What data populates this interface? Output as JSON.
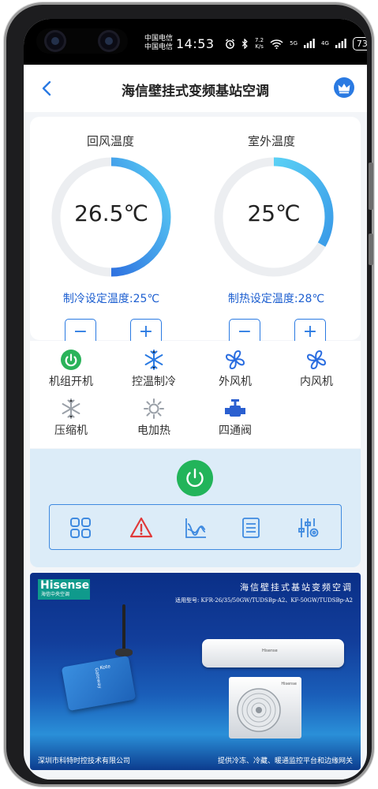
{
  "status_bar": {
    "carrier_1": "中国电信",
    "carrier_2": "中国电信",
    "time": "14:53",
    "net_speed_value": "7.2",
    "net_speed_unit": "K/s",
    "signal_1_tag": "5G",
    "signal_2_tag": "4G",
    "battery": "73"
  },
  "header": {
    "title": "海信壁挂式变频基站空调"
  },
  "temps": {
    "return_air": {
      "label": "回风温度",
      "value": "26.5℃",
      "setpoint": "制冷设定温度:25℃"
    },
    "outdoor": {
      "label": "室外温度",
      "value": "25℃",
      "setpoint": "制热设定温度:28℃"
    },
    "minus": "−",
    "plus": "+"
  },
  "status_items": [
    {
      "label": "机组开机",
      "icon": "power-icon",
      "state": "on",
      "color": "#2bb35a"
    },
    {
      "label": "控温制冷",
      "icon": "snowflake-icon",
      "state": "on",
      "color": "#2a7ae2"
    },
    {
      "label": "外风机",
      "icon": "fan-icon",
      "state": "on",
      "color": "#2a6de0"
    },
    {
      "label": "内风机",
      "icon": "fan-icon",
      "state": "on",
      "color": "#2a6de0"
    },
    {
      "label": "压缩机",
      "icon": "snowflake-icon",
      "state": "off",
      "color": "#9aa0a8"
    },
    {
      "label": "电加热",
      "icon": "sun-icon",
      "state": "off",
      "color": "#9aa0a8"
    },
    {
      "label": "四通阀",
      "icon": "valve-icon",
      "state": "on",
      "color": "#2a5fd0"
    }
  ],
  "toolbar": {
    "icons": [
      "grid-icon",
      "alarm-icon",
      "chart-icon",
      "list-icon",
      "settings-icon"
    ]
  },
  "banner": {
    "brand": "Hisense",
    "brand_sub": "海信中央空调",
    "title": "海信壁挂式基站变频空调",
    "models": "适用型号: KFR-26/35/50GW/TUDSBp-A2、KF-50GW/TUDSBp-A2",
    "footer_left": "深圳市科特时控技术有限公司",
    "footer_right": "提供冷冻、冷藏、暖通监控平台和边缘网关"
  },
  "colors": {
    "accent": "#2a7ae2",
    "gauge_track": "#eceef1",
    "gauge_start": "#2f72e0",
    "gauge_end": "#5ad0f5",
    "power_green": "#22b45a",
    "alarm_red": "#e03a3a"
  }
}
